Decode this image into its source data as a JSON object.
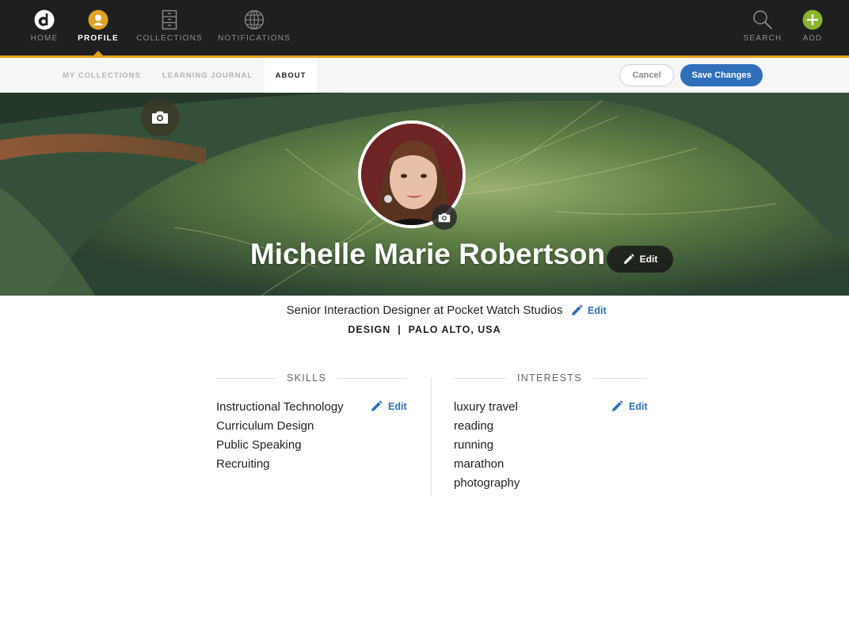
{
  "nav": {
    "items": [
      {
        "label": "HOME",
        "icon": "home-logo-icon"
      },
      {
        "label": "PROFILE",
        "icon": "profile-icon"
      },
      {
        "label": "COLLECTIONS",
        "icon": "cabinet-icon"
      },
      {
        "label": "NOTIFICATIONS",
        "icon": "globe-icon"
      },
      {
        "label": "SEARCH",
        "icon": "search-icon"
      },
      {
        "label": "ADD",
        "icon": "plus-icon"
      }
    ],
    "active": "PROFILE"
  },
  "subnav": {
    "tabs": [
      {
        "label": "MY COLLECTIONS"
      },
      {
        "label": "LEARNING JOURNAL"
      },
      {
        "label": "ABOUT"
      }
    ],
    "active": "ABOUT",
    "cancel_label": "Cancel",
    "save_label": "Save Changes"
  },
  "profile": {
    "name": "Michelle Marie Robertson",
    "name_edit_label": "Edit",
    "job_title": "Senior Interaction Designer at Pocket Watch Studios",
    "job_edit_label": "Edit",
    "meta": "DESIGN  |  PALO ALTO, USA"
  },
  "skills": {
    "title": "SKILLS",
    "edit_label": "Edit",
    "items": [
      "Instructional Technology",
      "Curriculum Design",
      "Public Speaking",
      "Recruiting"
    ]
  },
  "interests": {
    "title": "INTERESTS",
    "edit_label": "Edit",
    "items": [
      "luxury travel",
      "reading",
      "running",
      "marathon",
      "photography"
    ]
  },
  "colors": {
    "nav_bg": "#1f1f1f",
    "accent": "#e0a21f",
    "primary_blue": "#2f6fbc",
    "add_green": "#8ab52d"
  }
}
